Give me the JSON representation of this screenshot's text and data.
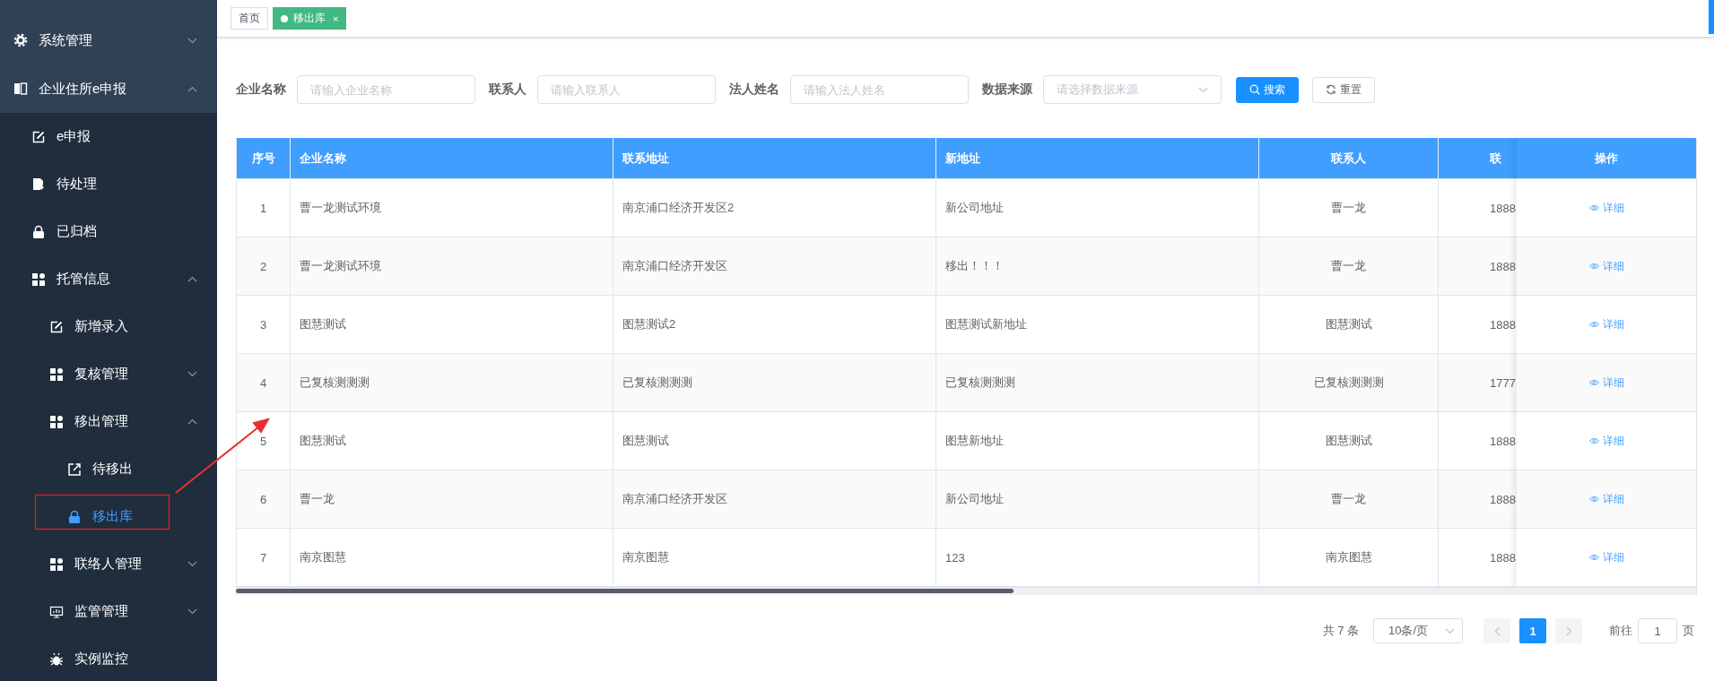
{
  "sidebar": {
    "items": [
      {
        "label": "系统管理",
        "expanded": false,
        "selected": false
      },
      {
        "label": "企业住所e申报",
        "expanded": true,
        "selected": false,
        "children": [
          {
            "label": "e申报",
            "selected": false
          },
          {
            "label": "待处理",
            "selected": false
          },
          {
            "label": "已归档",
            "selected": false
          },
          {
            "label": "托管信息",
            "expanded": true,
            "selected": false,
            "children": [
              {
                "label": "新增录入",
                "selected": false
              },
              {
                "label": "复核管理",
                "expanded": false,
                "selected": false
              },
              {
                "label": "移出管理",
                "expanded": true,
                "selected": false,
                "children": [
                  {
                    "label": "待移出",
                    "selected": false
                  },
                  {
                    "label": "移出库",
                    "selected": true
                  }
                ]
              },
              {
                "label": "联络人管理",
                "expanded": false,
                "selected": false
              },
              {
                "label": "监管管理",
                "expanded": false,
                "selected": false
              },
              {
                "label": "实例监控",
                "selected": false
              }
            ]
          }
        ]
      }
    ]
  },
  "tags": [
    {
      "label": "首页",
      "selected": false
    },
    {
      "label": "移出库",
      "selected": true,
      "close": "×"
    }
  ],
  "filters": [
    {
      "kind": "input",
      "label": "企业名称",
      "placeholder": "请输入企业名称"
    },
    {
      "kind": "input",
      "label": "联系人",
      "placeholder": "请输入联系人"
    },
    {
      "kind": "input",
      "label": "法人姓名",
      "placeholder": "请输入法人姓名"
    },
    {
      "kind": "select",
      "label": "数据来源",
      "placeholder": "请选择数据来源"
    }
  ],
  "buttons": [
    {
      "kind": "primary",
      "label": "搜索"
    },
    {
      "kind": "default",
      "label": "重置"
    }
  ],
  "table": {
    "columns": [
      "序号",
      "企业名称",
      "联系地址",
      "新地址",
      "联系人",
      "联"
    ],
    "fixed_column": "操作",
    "rows": [
      {
        "cells": [
          "1",
          "曹一龙测试环境",
          "南京浦口经济开发区2",
          "新公司地址",
          "曹一龙",
          "1888"
        ],
        "action": "详细"
      },
      {
        "cells": [
          "2",
          "曹一龙测试环境",
          "南京浦口经济开发区",
          "移出！！！",
          "曹一龙",
          "1888"
        ],
        "action": "详细"
      },
      {
        "cells": [
          "3",
          "图慧测试",
          "图慧测试2",
          "图慧测试新地址",
          "图慧测试",
          "1888"
        ],
        "action": "详细"
      },
      {
        "cells": [
          "4",
          "已复核测测测",
          "已复核测测测",
          "已复核测测测",
          "已复核测测测",
          "1777"
        ],
        "action": "详细"
      },
      {
        "cells": [
          "5",
          "图慧测试",
          "图慧测试",
          "图慧新地址",
          "图慧测试",
          "1888"
        ],
        "action": "详细"
      },
      {
        "cells": [
          "6",
          "曹一龙",
          "南京浦口经济开发区",
          "新公司地址",
          "曹一龙",
          "1888"
        ],
        "action": "详细"
      },
      {
        "cells": [
          "7",
          "南京图慧",
          "南京图慧",
          "123",
          "南京图慧",
          "1888"
        ],
        "action": "详细"
      }
    ]
  },
  "pagination": {
    "total": "共 7 条",
    "page_size": "10条/页",
    "pages": [
      {
        "label": "1",
        "selected": true
      }
    ],
    "goto_label": "前往",
    "goto_value": "1",
    "goto_suffix": "页"
  }
}
